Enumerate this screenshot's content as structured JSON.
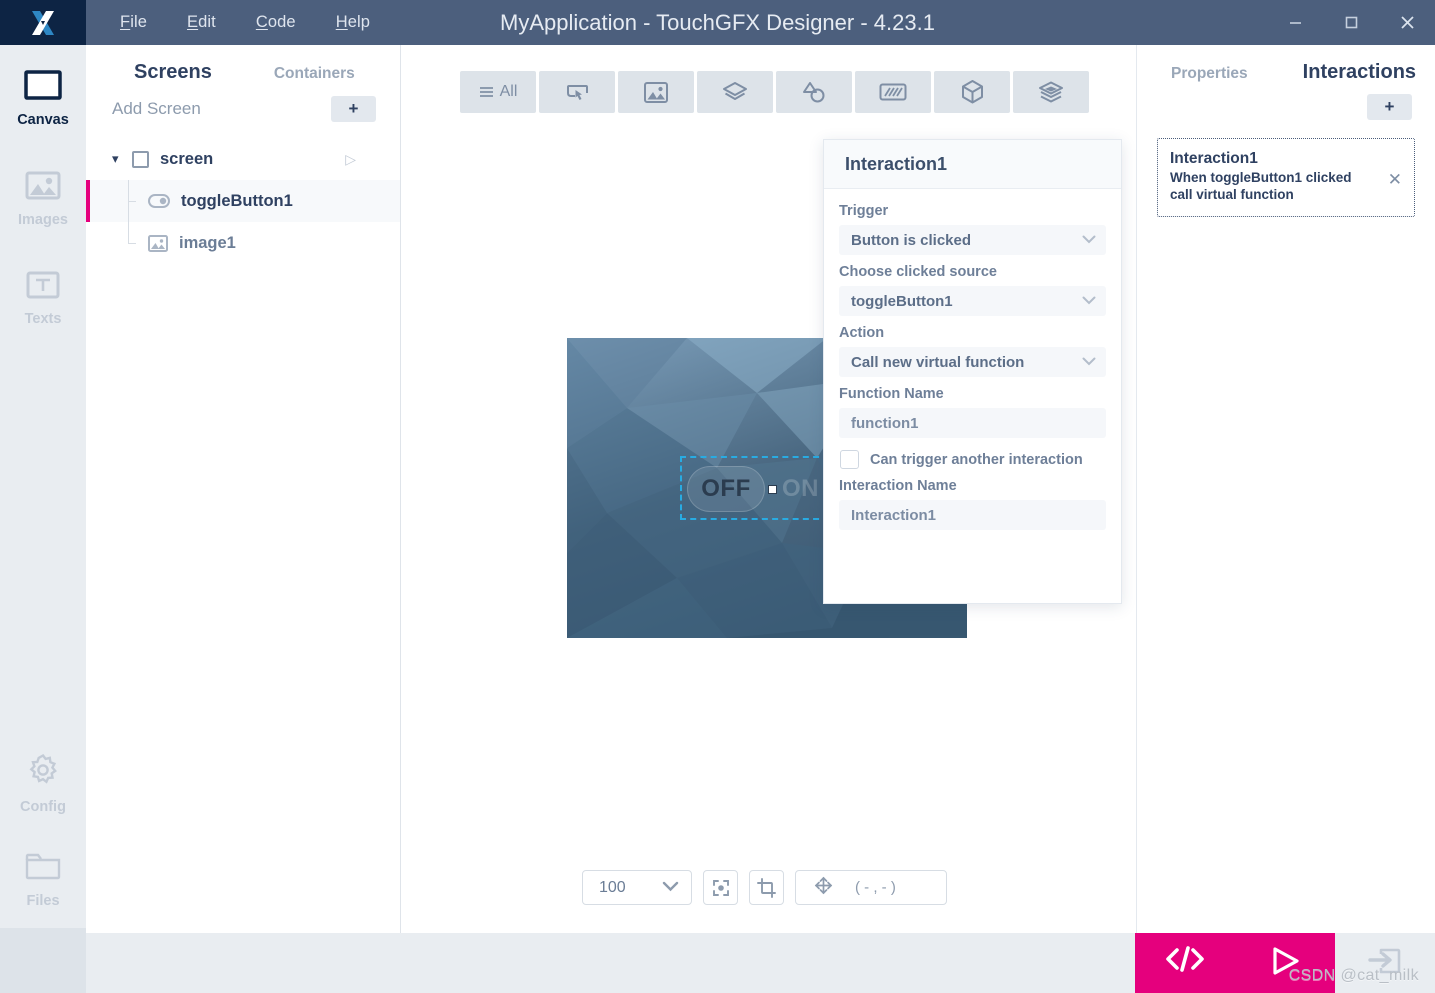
{
  "titlebar": {
    "app_title": "MyApplication - TouchGFX Designer - 4.23.1",
    "logo_icon": "touchgfx-x-logo",
    "menus": [
      {
        "label": "File",
        "accel": "F"
      },
      {
        "label": "Edit",
        "accel": "E"
      },
      {
        "label": "Code",
        "accel": "C"
      },
      {
        "label": "Help",
        "accel": "H"
      }
    ],
    "window_controls": [
      {
        "name": "minimize",
        "glyph": "–"
      },
      {
        "name": "maximize",
        "glyph": "□"
      },
      {
        "name": "close",
        "glyph": "✕"
      }
    ]
  },
  "rail": {
    "items": [
      {
        "label": "Canvas",
        "icon": "canvas-icon",
        "active": true
      },
      {
        "label": "Images",
        "icon": "images-icon",
        "active": false
      },
      {
        "label": "Texts",
        "icon": "texts-icon",
        "active": false
      },
      {
        "label": "Config",
        "icon": "gear-icon",
        "active": false
      },
      {
        "label": "Files",
        "icon": "folder-icon",
        "active": false
      }
    ],
    "menu_toggle_icon": "hamburger-icon"
  },
  "screens_panel": {
    "tabs": [
      {
        "label": "Screens",
        "active": true
      },
      {
        "label": "Containers",
        "active": false
      }
    ],
    "add_screen_label": "Add Screen",
    "add_button_glyph": "+",
    "tree": [
      {
        "label": "screen",
        "icon": "checkbox-icon",
        "level": 0,
        "selected": false,
        "expanded": true,
        "has_play": true
      },
      {
        "label": "toggleButton1",
        "icon": "toggle-button-icon",
        "level": 1,
        "selected": true
      },
      {
        "label": "image1",
        "icon": "image-icon",
        "level": 1,
        "selected": false
      }
    ]
  },
  "widget_toolbar": {
    "all_label": "All",
    "buttons": [
      {
        "name": "filter-all",
        "icon": "hamburger-icon"
      },
      {
        "name": "buttons-category",
        "icon": "button-touch-icon"
      },
      {
        "name": "images-category",
        "icon": "image-icon"
      },
      {
        "name": "shapes-category",
        "icon": "layers-icon"
      },
      {
        "name": "drawables-category",
        "icon": "shape-circle-icon"
      },
      {
        "name": "gauges-category",
        "icon": "texture-icon"
      },
      {
        "name": "3d-category",
        "icon": "cube-icon"
      },
      {
        "name": "containers-category",
        "icon": "stacked-layers-icon"
      }
    ]
  },
  "canvas": {
    "toggle_button": {
      "off_label": "OFF",
      "on_label": "ON",
      "state": "OFF"
    },
    "statusbar": {
      "zoom_value": "100",
      "coordinates": "( - , - )",
      "buttons": [
        {
          "name": "fit-to-screen",
          "icon": "focus-target-icon"
        },
        {
          "name": "crop",
          "icon": "crop-icon"
        },
        {
          "name": "move",
          "icon": "move-arrows-icon"
        }
      ]
    }
  },
  "dialog": {
    "title": "Interaction1",
    "trigger_label": "Trigger",
    "trigger_value": "Button is clicked",
    "source_label": "Choose clicked source",
    "source_value": "toggleButton1",
    "action_label": "Action",
    "action_value": "Call new virtual function",
    "function_name_label": "Function Name",
    "function_name_value": "function1",
    "can_trigger_label": "Can trigger another interaction",
    "can_trigger_checked": false,
    "interaction_name_label": "Interaction Name",
    "interaction_name_value": "Interaction1"
  },
  "right_panel": {
    "tabs": [
      {
        "label": "Properties",
        "active": false
      },
      {
        "label": "Interactions",
        "active": true
      }
    ],
    "add_button_glyph": "+",
    "cards": [
      {
        "title": "Interaction1",
        "desc_line1": "When toggleButton1 clicked",
        "desc_line2": "call virtual function",
        "close_glyph": "✕"
      }
    ]
  },
  "bottom_bar": {
    "accent_color": "#e5007d",
    "actions": [
      {
        "name": "generate-code",
        "icon": "code-brackets-icon",
        "glyph": "</>"
      },
      {
        "name": "run-simulator",
        "icon": "play-icon",
        "glyph": "▷"
      },
      {
        "name": "export-project",
        "icon": "export-arrow-icon",
        "disabled": true
      }
    ],
    "watermark": "CSDN @cat_milk"
  }
}
